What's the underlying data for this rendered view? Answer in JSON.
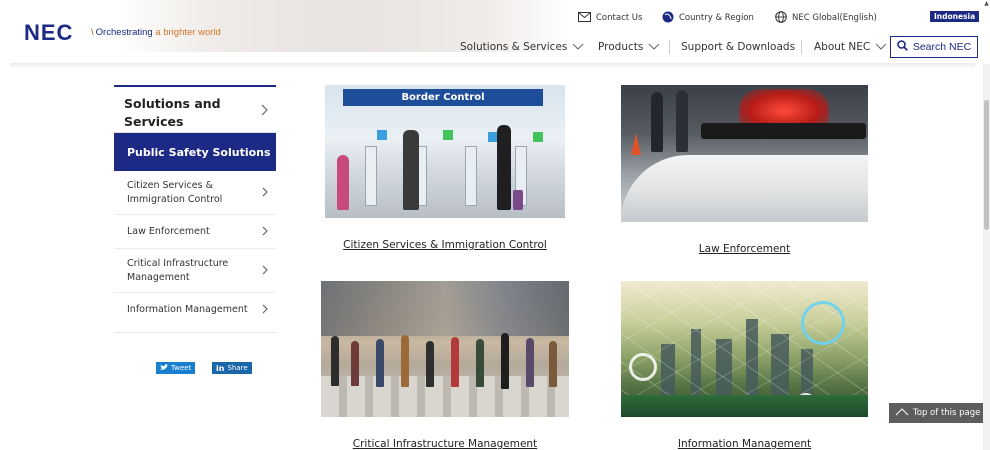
{
  "header": {
    "logo": "NEC",
    "tagline_slash": "\\",
    "tagline_main": "Orchestrating",
    "tagline_accent": "a brighter world",
    "utility": {
      "contact": "Contact Us",
      "country": "Country & Region",
      "global": "NEC Global(English)",
      "region_badge": "Indonesia"
    },
    "nav": {
      "solutions": "Solutions & Services",
      "products": "Products",
      "support": "Support & Downloads",
      "about": "About NEC"
    },
    "search_label": "Search NEC"
  },
  "sidebar": {
    "title": "Solutions and Services",
    "active_item": "Public Safety Solutions",
    "items": [
      {
        "label": "Citizen Services & Immigration Control"
      },
      {
        "label": "Law Enforcement"
      },
      {
        "label": "Critical Infrastructure Management"
      },
      {
        "label": "Information Management"
      }
    ]
  },
  "share": {
    "tweet": "Tweet",
    "linkedin_mark": "in",
    "linkedin": "Share"
  },
  "cards": [
    {
      "label": "Citizen Services & Immigration Control",
      "image_text": "Border Control"
    },
    {
      "label": "Law Enforcement"
    },
    {
      "label": "Critical Infrastructure Management"
    },
    {
      "label": "Information Management"
    }
  ],
  "top_button": "Top of this page",
  "colors": {
    "brand_navy": "#1c2a86",
    "tagline_accent": "#d2762e",
    "twitter_blue": "#1b7fd1",
    "top_button_bg": "#5d5d5d"
  },
  "icons": {
    "contact": "envelope-icon",
    "country": "globe-icon",
    "global": "world-icon",
    "search": "magnifier-icon",
    "chevron": "chevron-right-icon",
    "nav_chevron": "chevron-down-icon",
    "top": "triangle-up-icon"
  }
}
